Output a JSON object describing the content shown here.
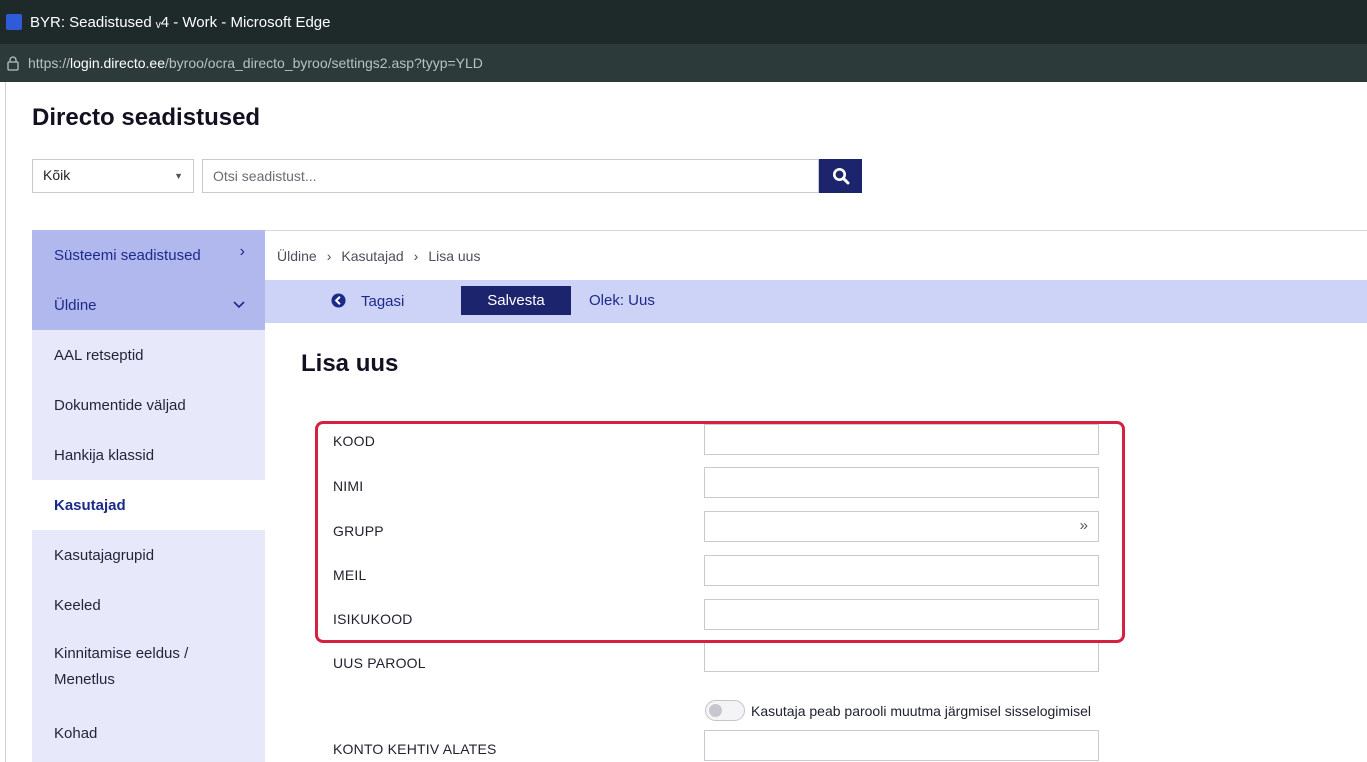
{
  "window": {
    "title": "BYR: Seadistused ᵥ4 - Work - Microsoft Edge",
    "url_prefix": "https://",
    "url_host": "login.directo.ee",
    "url_path": "/byroo/ocra_directo_byroo/settings2.asp?tyyp=YLD"
  },
  "header": {
    "title": "Directo seadistused",
    "filter_value": "Kõik",
    "search_placeholder": "Otsi seadistust..."
  },
  "sidebar": {
    "system_settings": "Süsteemi seadistused",
    "section": "Üldine",
    "items": [
      "AAL retseptid",
      "Dokumentide väljad",
      "Hankija klassid",
      "Kasutajad",
      "Kasutajagrupid",
      "Keeled",
      "Kinnitamise eeldus / Menetlus",
      "Kohad"
    ],
    "active_index": 3
  },
  "breadcrumb": [
    "Üldine",
    "Kasutajad",
    "Lisa uus"
  ],
  "actionbar": {
    "back_label": "Tagasi",
    "save_label": "Salvesta",
    "status": "Olek: Uus"
  },
  "form": {
    "title": "Lisa uus",
    "fields": {
      "kood": {
        "label": "KOOD",
        "value": ""
      },
      "nimi": {
        "label": "NIMI",
        "value": ""
      },
      "grupp": {
        "label": "GRUPP",
        "value": ""
      },
      "meil": {
        "label": "MEIL",
        "value": ""
      },
      "isikukood": {
        "label": "ISIKUKOOD",
        "value": ""
      },
      "uus_parool": {
        "label": "UUS PAROOL",
        "value": ""
      },
      "konto_kehtiv_alates": {
        "label": "KONTO KEHTIV ALATES",
        "value": ""
      }
    },
    "toggle": {
      "label": "Kasutaja peab parooli muutma järgmisel sisselogimisel",
      "on": false
    }
  },
  "colors": {
    "accent": "#1c246e",
    "sidebar_bg": "#e7e9fa",
    "sidebar_head": "#b1b8ee",
    "actionbar": "#cdd3f6",
    "highlight": "#d62040"
  },
  "icons": [
    "app-icon",
    "lock-icon",
    "dropdown-arrow-icon",
    "search-icon",
    "chevron-right-icon",
    "chevron-down-icon",
    "back-arrow-icon",
    "double-chevron-right-icon"
  ]
}
